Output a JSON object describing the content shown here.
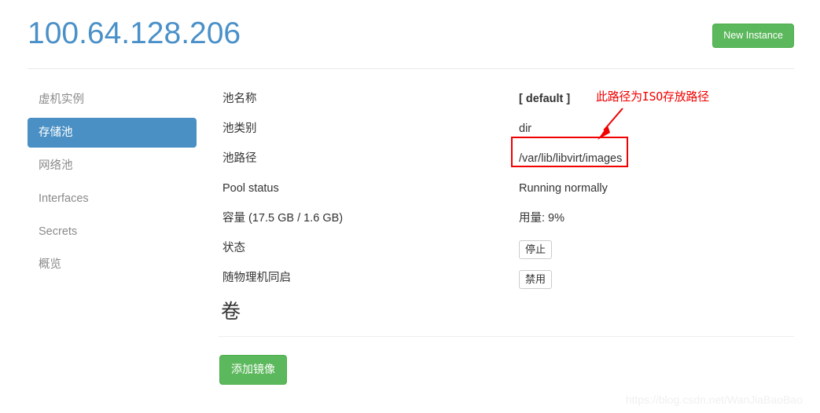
{
  "header": {
    "title": "100.64.128.206",
    "new_instance_label": "New Instance",
    "accent_color": "#4a90c8",
    "button_color": "#5cb85c"
  },
  "sidebar": {
    "active_color": "#4a90c4",
    "items": [
      {
        "label": "虚机实例",
        "active": false
      },
      {
        "label": "存储池",
        "active": true
      },
      {
        "label": "网络池",
        "active": false
      },
      {
        "label": "Interfaces",
        "active": false
      },
      {
        "label": "Secrets",
        "active": false
      },
      {
        "label": "概览",
        "active": false
      }
    ]
  },
  "details": {
    "rows": [
      {
        "label": "池名称",
        "value": "[ default ]",
        "type": "strong"
      },
      {
        "label": "池类别",
        "value": "dir",
        "type": "text"
      },
      {
        "label": "池路径",
        "value": "/var/lib/libvirt/images",
        "type": "text"
      },
      {
        "label": "Pool status",
        "value": "Running normally",
        "type": "text"
      },
      {
        "label": "容量 (17.5 GB / 1.6 GB)",
        "value": "用量: 9%",
        "type": "text"
      },
      {
        "label": "状态",
        "value": "停止",
        "type": "button"
      },
      {
        "label": "随物理机同启",
        "value": "禁用",
        "type": "button"
      }
    ]
  },
  "volumes": {
    "heading": "卷",
    "add_image_label": "添加镜像"
  },
  "annotation": {
    "text": "此路径为ISO存放路径",
    "color": "#f00000",
    "target": "/var/lib/libvirt/images"
  },
  "watermark": {
    "text": "https://blog.csdn.net/WanJiaBaoBao"
  }
}
